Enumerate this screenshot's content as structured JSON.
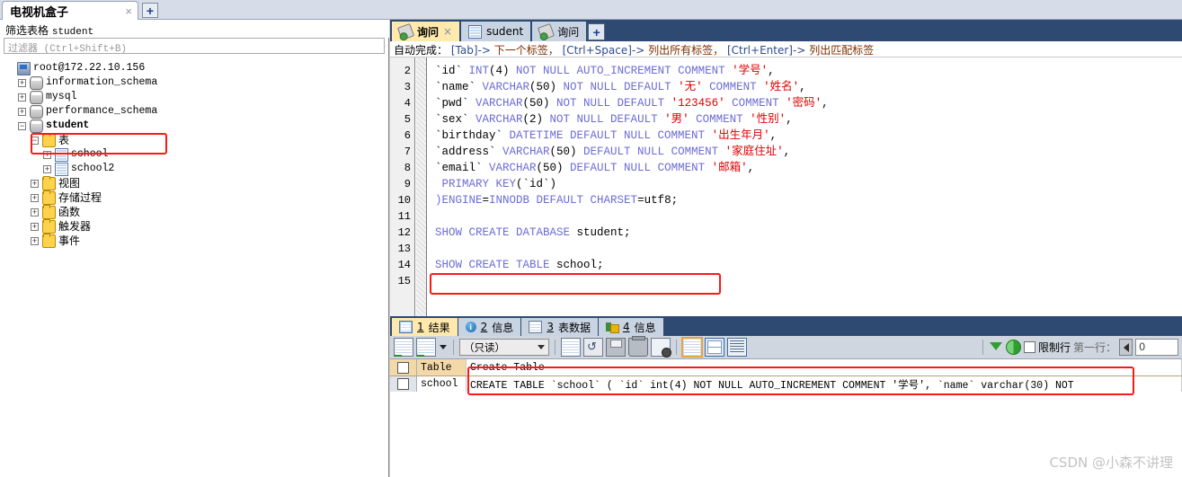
{
  "connection_tabbar": {
    "tab_title": "电视机盒子",
    "close_label": "×",
    "new_tab_label": "+"
  },
  "sidebar": {
    "filter_label_cn": "筛选表格",
    "filter_label_obj": "student",
    "filter_placeholder": "过滤器 (Ctrl+Shift+B)",
    "tree": [
      {
        "label": "root@172.22.10.156",
        "icon": "server-icon",
        "expander": "",
        "depth": 0,
        "bold": false,
        "cjk": false
      },
      {
        "label": "information_schema",
        "icon": "database-icon",
        "expander": "+",
        "depth": 1,
        "bold": false,
        "cjk": false
      },
      {
        "label": "mysql",
        "icon": "database-icon",
        "expander": "+",
        "depth": 1,
        "bold": false,
        "cjk": false
      },
      {
        "label": "performance_schema",
        "icon": "database-icon",
        "expander": "+",
        "depth": 1,
        "bold": false,
        "cjk": false
      },
      {
        "label": "student",
        "icon": "database-icon",
        "expander": "−",
        "depth": 1,
        "bold": true,
        "cjk": false
      },
      {
        "label": "表",
        "icon": "folder-icon",
        "expander": "−",
        "depth": 2,
        "bold": false,
        "cjk": true
      },
      {
        "label": "school",
        "icon": "table-icon",
        "expander": "+",
        "depth": 3,
        "bold": false,
        "cjk": false
      },
      {
        "label": "school2",
        "icon": "table-icon",
        "expander": "+",
        "depth": 3,
        "bold": false,
        "cjk": false
      },
      {
        "label": "视图",
        "icon": "folder-icon",
        "expander": "+",
        "depth": 2,
        "bold": false,
        "cjk": true
      },
      {
        "label": "存储过程",
        "icon": "folder-icon",
        "expander": "+",
        "depth": 2,
        "bold": false,
        "cjk": true
      },
      {
        "label": "函数",
        "icon": "folder-icon",
        "expander": "+",
        "depth": 2,
        "bold": false,
        "cjk": true
      },
      {
        "label": "触发器",
        "icon": "folder-icon",
        "expander": "+",
        "depth": 2,
        "bold": false,
        "cjk": true
      },
      {
        "label": "事件",
        "icon": "folder-icon",
        "expander": "+",
        "depth": 2,
        "bold": false,
        "cjk": true
      }
    ]
  },
  "editor_tabs": [
    {
      "label": "询问",
      "icon": "query-icon",
      "active": true,
      "closable": true,
      "close_label": "×"
    },
    {
      "label": "sudent",
      "icon": "table-icon",
      "active": false,
      "closable": false,
      "close_label": ""
    },
    {
      "label": "询问",
      "icon": "query-icon",
      "active": false,
      "closable": false,
      "close_label": ""
    }
  ],
  "editor_new_tab_label": "+",
  "hintbar": {
    "prefix": "自动完成：",
    "k1": "[Tab]->",
    "v1": "下一个标签，",
    "k2": "[Ctrl+Space]->",
    "v2": "列出所有标签，",
    "k3": "[Ctrl+Enter]->",
    "v3": "列出匹配标签"
  },
  "sql_lines": [
    {
      "n": "2",
      "tokens": [
        {
          "t": "`id` ",
          "c": "idt"
        },
        {
          "t": "INT",
          "c": "kw"
        },
        {
          "t": "(4) ",
          "c": "idt"
        },
        {
          "t": "NOT NULL AUTO_INCREMENT COMMENT ",
          "c": "kw"
        },
        {
          "t": "'学号'",
          "c": "str"
        },
        {
          "t": ",",
          "c": "idt"
        }
      ]
    },
    {
      "n": "3",
      "tokens": [
        {
          "t": "`name` ",
          "c": "idt"
        },
        {
          "t": "VARCHAR",
          "c": "kw"
        },
        {
          "t": "(50) ",
          "c": "idt"
        },
        {
          "t": "NOT NULL DEFAULT ",
          "c": "kw"
        },
        {
          "t": "'无'",
          "c": "str"
        },
        {
          "t": " COMMENT ",
          "c": "kw"
        },
        {
          "t": "'姓名'",
          "c": "str"
        },
        {
          "t": ",",
          "c": "idt"
        }
      ]
    },
    {
      "n": "4",
      "tokens": [
        {
          "t": "`pwd` ",
          "c": "idt"
        },
        {
          "t": "VARCHAR",
          "c": "kw"
        },
        {
          "t": "(50) ",
          "c": "idt"
        },
        {
          "t": "NOT NULL DEFAULT ",
          "c": "kw"
        },
        {
          "t": "'123456'",
          "c": "str"
        },
        {
          "t": " COMMENT ",
          "c": "kw"
        },
        {
          "t": "'密码'",
          "c": "str"
        },
        {
          "t": ",",
          "c": "idt"
        }
      ]
    },
    {
      "n": "5",
      "tokens": [
        {
          "t": "`sex` ",
          "c": "idt"
        },
        {
          "t": "VARCHAR",
          "c": "kw"
        },
        {
          "t": "(2) ",
          "c": "idt"
        },
        {
          "t": "NOT NULL DEFAULT ",
          "c": "kw"
        },
        {
          "t": "'男'",
          "c": "str"
        },
        {
          "t": " COMMENT ",
          "c": "kw"
        },
        {
          "t": "'性别'",
          "c": "str"
        },
        {
          "t": ",",
          "c": "idt"
        }
      ]
    },
    {
      "n": "6",
      "tokens": [
        {
          "t": "`birthday` ",
          "c": "idt"
        },
        {
          "t": "DATETIME DEFAULT NULL COMMENT ",
          "c": "kw"
        },
        {
          "t": "'出生年月'",
          "c": "str"
        },
        {
          "t": ",",
          "c": "idt"
        }
      ]
    },
    {
      "n": "7",
      "tokens": [
        {
          "t": "`address` ",
          "c": "idt"
        },
        {
          "t": "VARCHAR",
          "c": "kw"
        },
        {
          "t": "(50) ",
          "c": "idt"
        },
        {
          "t": "DEFAULT NULL COMMENT ",
          "c": "kw"
        },
        {
          "t": "'家庭住址'",
          "c": "str"
        },
        {
          "t": ",",
          "c": "idt"
        }
      ]
    },
    {
      "n": "8",
      "tokens": [
        {
          "t": "`email` ",
          "c": "idt"
        },
        {
          "t": "VARCHAR",
          "c": "kw"
        },
        {
          "t": "(50) ",
          "c": "idt"
        },
        {
          "t": "DEFAULT NULL COMMENT ",
          "c": "kw"
        },
        {
          "t": "'邮箱'",
          "c": "str"
        },
        {
          "t": ",",
          "c": "idt"
        }
      ]
    },
    {
      "n": "9",
      "tokens": [
        {
          "t": " PRIMARY KEY",
          "c": "kw"
        },
        {
          "t": "(`id`)",
          "c": "idt"
        }
      ]
    },
    {
      "n": "10",
      "tokens": [
        {
          "t": ")ENGINE",
          "c": "kw"
        },
        {
          "t": "=",
          "c": "idt"
        },
        {
          "t": "INNODB DEFAULT CHARSET",
          "c": "kw"
        },
        {
          "t": "=utf8;",
          "c": "idt"
        }
      ]
    },
    {
      "n": "11",
      "tokens": []
    },
    {
      "n": "12",
      "tokens": [
        {
          "t": "SHOW CREATE DATABASE ",
          "c": "kw"
        },
        {
          "t": "student;",
          "c": "idt"
        }
      ]
    },
    {
      "n": "13",
      "tokens": []
    },
    {
      "n": "14",
      "tokens": [
        {
          "t": "SHOW CREATE TABLE ",
          "c": "kw"
        },
        {
          "t": "school;",
          "c": "idt"
        }
      ]
    },
    {
      "n": "15",
      "tokens": []
    }
  ],
  "result_tabs": [
    {
      "num": "1",
      "label": "结果",
      "icon": "result-grid-icon",
      "active": true
    },
    {
      "num": "2",
      "label": "信息",
      "icon": "info-icon",
      "active": false
    },
    {
      "num": "3",
      "label": "表数据",
      "icon": "table-data-icon",
      "active": false
    },
    {
      "num": "4",
      "label": "信息",
      "icon": "profile-icon",
      "active": false
    }
  ],
  "result_toolbar": {
    "mode_value": "（只读）",
    "limit_rows_label": "限制行",
    "first_row_label": "第一行：",
    "first_row_value": "0"
  },
  "result_grid": {
    "columns": [
      "Table",
      "Create Table"
    ],
    "rows": [
      {
        "table": "school",
        "create_table": "CREATE TABLE `school` (  `id` int(4) NOT NULL AUTO_INCREMENT COMMENT '学号',  `name` varchar(30) NOT"
      }
    ]
  },
  "watermark": "CSDN @小森不讲理",
  "colors": {
    "accent_tab": "#ffe9ad",
    "tabbar_dark": "#2e4a73",
    "annotation_red": "#fc1a13",
    "keyword_blue": "#6b6bd6",
    "string_red": "#e00000",
    "header_orange": "#f3d9a8"
  }
}
